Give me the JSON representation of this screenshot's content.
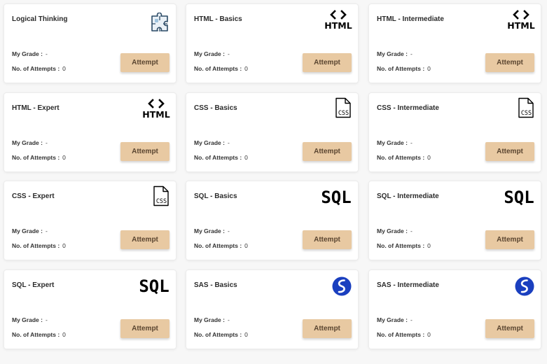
{
  "labels": {
    "grade": "My Grade :",
    "attempts": "No. of Attempts :"
  },
  "accent": {
    "button_bg": "#e8c9a2",
    "sas_blue": "#1a3fbf"
  },
  "cards": [
    {
      "title": "Logical Thinking",
      "icon": "puzzle-icon",
      "grade": "-",
      "attempts": "0",
      "button": "Attempt"
    },
    {
      "title": "HTML - Basics",
      "icon": "html-icon",
      "grade": "-",
      "attempts": "0",
      "button": "Attempt"
    },
    {
      "title": "HTML - Intermediate",
      "icon": "html-icon",
      "grade": "-",
      "attempts": "0",
      "button": "Attempt"
    },
    {
      "title": "HTML - Expert",
      "icon": "html-icon",
      "grade": "-",
      "attempts": "0",
      "button": "Attempt"
    },
    {
      "title": "CSS - Basics",
      "icon": "css-file-icon",
      "grade": "-",
      "attempts": "0",
      "button": "Attempt"
    },
    {
      "title": "CSS - Intermediate",
      "icon": "css-file-icon",
      "grade": "-",
      "attempts": "0",
      "button": "Attempt"
    },
    {
      "title": "CSS - Expert",
      "icon": "css-file-icon",
      "grade": "-",
      "attempts": "0",
      "button": "Attempt"
    },
    {
      "title": "SQL - Basics",
      "icon": "sql-icon",
      "grade": "-",
      "attempts": "0",
      "button": "Attempt"
    },
    {
      "title": "SQL - Intermediate",
      "icon": "sql-icon",
      "grade": "-",
      "attempts": "0",
      "button": "Attempt"
    },
    {
      "title": "SQL - Expert",
      "icon": "sql-icon",
      "grade": "-",
      "attempts": "0",
      "button": "Attempt"
    },
    {
      "title": "SAS - Basics",
      "icon": "sas-logo-icon",
      "grade": "-",
      "attempts": "0",
      "button": "Attempt"
    },
    {
      "title": "SAS - Intermediate",
      "icon": "sas-logo-icon",
      "grade": "-",
      "attempts": "0",
      "button": "Attempt"
    }
  ]
}
